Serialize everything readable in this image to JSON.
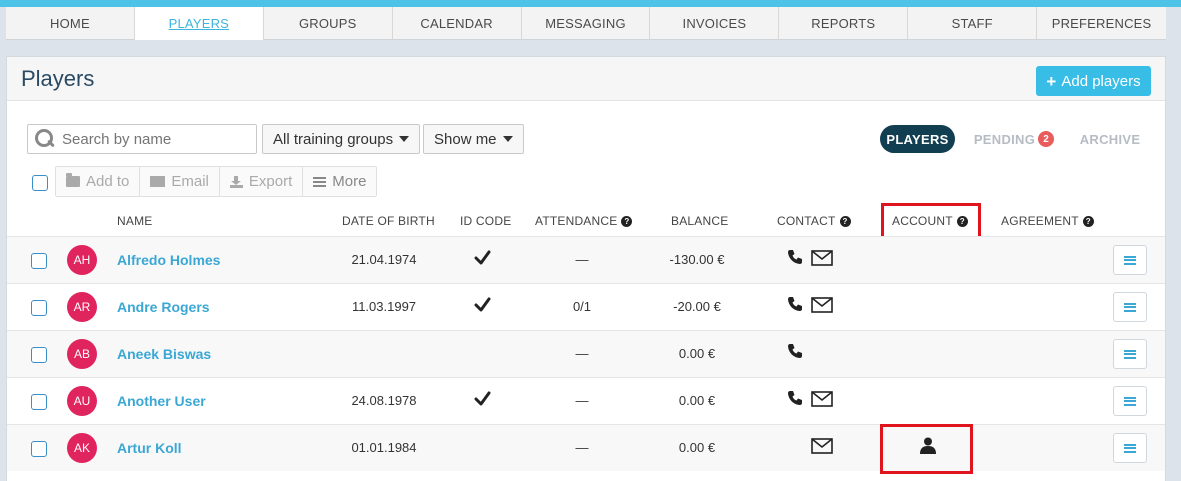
{
  "nav": {
    "tabs": [
      "HOME",
      "PLAYERS",
      "GROUPS",
      "CALENDAR",
      "MESSAGING",
      "INVOICES",
      "REPORTS",
      "STAFF",
      "PREFERENCES"
    ],
    "active": "PLAYERS"
  },
  "header": {
    "title": "Players",
    "add_label": "Add players"
  },
  "search": {
    "placeholder": "Search by name",
    "value": ""
  },
  "filters": {
    "groups": "All training groups",
    "show": "Show me"
  },
  "views": {
    "players": "PLAYERS",
    "pending": "PENDING",
    "pending_count": "2",
    "archive": "ARCHIVE"
  },
  "actions": {
    "add_to": "Add to",
    "email": "Email",
    "export": "Export",
    "more": "More"
  },
  "columns": {
    "name": "NAME",
    "dob": "DATE OF BIRTH",
    "id_code": "ID CODE",
    "attendance": "ATTENDANCE",
    "balance": "BALANCE",
    "contact": "CONTACT",
    "account": "ACCOUNT",
    "agreement": "AGREEMENT"
  },
  "rows": [
    {
      "initials": "AH",
      "name": "Alfredo Holmes",
      "dob": "21.04.1974",
      "id_code": true,
      "attendance": "—",
      "balance": "-130.00 €",
      "phone": true,
      "email": true,
      "account": false
    },
    {
      "initials": "AR",
      "name": "Andre Rogers",
      "dob": "11.03.1997",
      "id_code": true,
      "attendance": "0/1",
      "balance": "-20.00 €",
      "phone": true,
      "email": true,
      "account": false
    },
    {
      "initials": "AB",
      "name": "Aneek Biswas",
      "dob": "",
      "id_code": false,
      "attendance": "—",
      "balance": "0.00 €",
      "phone": true,
      "email": false,
      "account": false
    },
    {
      "initials": "AU",
      "name": "Another User",
      "dob": "24.08.1978",
      "id_code": true,
      "attendance": "—",
      "balance": "0.00 €",
      "phone": true,
      "email": true,
      "account": false
    },
    {
      "initials": "AK",
      "name": "Artur Koll",
      "dob": "01.01.1984",
      "id_code": false,
      "attendance": "—",
      "balance": "0.00 €",
      "phone": false,
      "email": true,
      "account": true
    }
  ],
  "colors": {
    "accent": "#3aa7d4",
    "nav_strip": "#4ec3e8",
    "avatar": "#e0245e",
    "highlight": "#e0141d",
    "active_pill": "#123e52",
    "badge": "#e85c5c"
  },
  "icons": {
    "search": "search-icon",
    "caret": "caret-down-icon",
    "phone": "phone-icon",
    "email": "envelope-icon",
    "check": "checkmark-icon",
    "account": "user-icon",
    "menu": "hamburger-icon",
    "help": "question-circle-icon"
  }
}
